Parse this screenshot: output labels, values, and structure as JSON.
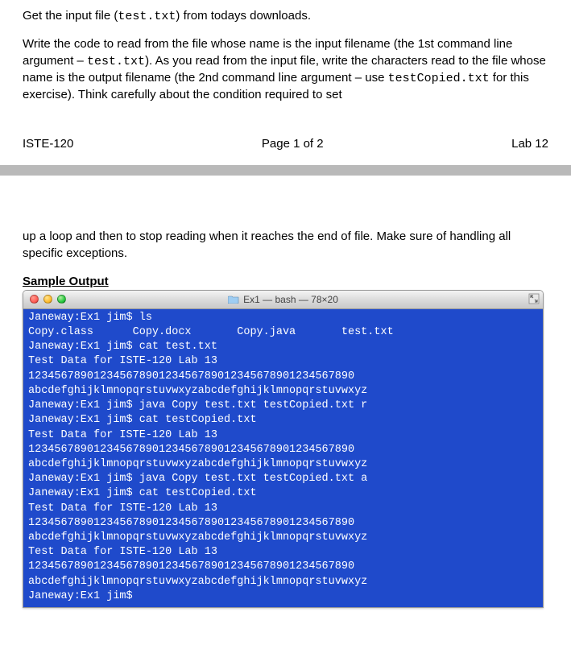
{
  "instructions": {
    "para1_pre": "Get the input file (",
    "para1_code": "test.txt",
    "para1_post": ") from todays downloads.",
    "para2_a": "Write the code to read from the file whose name is the input filename (the 1st command line argument – ",
    "para2_code1": "test.txt",
    "para2_b": ").  As you read from the input file, write the characters read to the file whose name is the output filename (the 2nd command line argument – use ",
    "para2_code2": "testCopied.txt",
    "para2_c": " for this exercise).  Think carefully about the condition required to set"
  },
  "footer": {
    "left": "ISTE-120",
    "center": "Page 1 of 2",
    "right": "Lab 12"
  },
  "continuation": "up a loop and then to stop reading when it reaches the end of file.  Make sure of handling all specific exceptions.",
  "sample_heading": "Sample Output",
  "terminal": {
    "title": "Ex1 — bash — 78×20",
    "lines": [
      "Janeway:Ex1 jim$ ls",
      "Copy.class      Copy.docx       Copy.java       test.txt",
      "Janeway:Ex1 jim$ cat test.txt",
      "Test Data for ISTE-120 Lab 13",
      "12345678901234567890123456789012345678901234567890",
      "abcdefghijklmnopqrstuvwxyzabcdefghijklmnopqrstuvwxyz",
      "Janeway:Ex1 jim$ java Copy test.txt testCopied.txt r",
      "Janeway:Ex1 jim$ cat testCopied.txt",
      "Test Data for ISTE-120 Lab 13",
      "12345678901234567890123456789012345678901234567890",
      "abcdefghijklmnopqrstuvwxyzabcdefghijklmnopqrstuvwxyz",
      "Janeway:Ex1 jim$ java Copy test.txt testCopied.txt a",
      "Janeway:Ex1 jim$ cat testCopied.txt",
      "Test Data for ISTE-120 Lab 13",
      "12345678901234567890123456789012345678901234567890",
      "abcdefghijklmnopqrstuvwxyzabcdefghijklmnopqrstuvwxyz",
      "Test Data for ISTE-120 Lab 13",
      "12345678901234567890123456789012345678901234567890",
      "abcdefghijklmnopqrstuvwxyzabcdefghijklmnopqrstuvwxyz",
      "Janeway:Ex1 jim$ "
    ]
  }
}
